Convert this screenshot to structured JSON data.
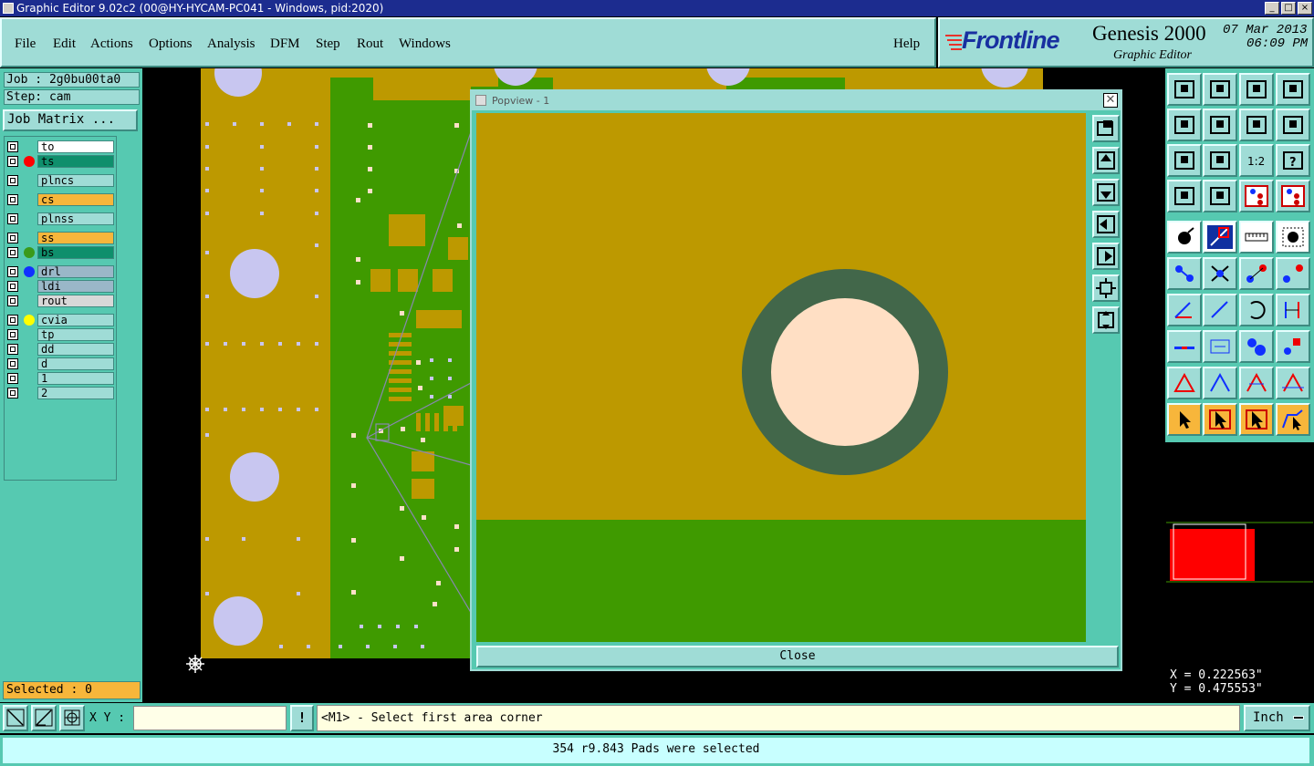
{
  "window": {
    "title": "Graphic Editor 9.02c2 (00@HY-HYCAM-PC041 - Windows, pid:2020)",
    "min": "_",
    "max": "□",
    "close": "×"
  },
  "menu": [
    "File",
    "Edit",
    "Actions",
    "Options",
    "Analysis",
    "DFM",
    "Step",
    "Rout",
    "Windows"
  ],
  "help": "Help",
  "brand": {
    "logo": "Frontline",
    "product": "Genesis 2000",
    "subtitle": "Graphic Editor",
    "date": "07 Mar 2013",
    "time": "06:09 PM"
  },
  "job": {
    "job_line": "Job : 2g0bu00ta0",
    "step_line": "Step: cam",
    "matrix_button": "Job Matrix ..."
  },
  "layers": [
    {
      "name": "to",
      "color": "#ffffff",
      "dot": ""
    },
    {
      "name": "ts",
      "color": "#0f8f6c",
      "dot": "#ff0000"
    },
    {
      "name": "plncs",
      "color": "#9fdcd6",
      "dot": ""
    },
    {
      "name": "cs",
      "color": "#f7b63b",
      "dot": ""
    },
    {
      "name": "plnss",
      "color": "#9fdcd6",
      "dot": ""
    },
    {
      "name": "ss",
      "color": "#f7b63b",
      "dot": ""
    },
    {
      "name": "bs",
      "color": "#0f8f6c",
      "dot": "#3a9a1a"
    },
    {
      "name": "drl",
      "color": "#9ab7c8",
      "dot": "#1030ff"
    },
    {
      "name": "ldi",
      "color": "#9ab7c8",
      "dot": ""
    },
    {
      "name": "rout",
      "color": "#d8d8d8",
      "dot": ""
    },
    {
      "name": "cvia",
      "color": "#9fdcd6",
      "dot": "#ffff00"
    },
    {
      "name": "tp",
      "color": "#9fdcd6",
      "dot": ""
    },
    {
      "name": "dd",
      "color": "#9fdcd6",
      "dot": ""
    },
    {
      "name": "d",
      "color": "#9fdcd6",
      "dot": ""
    },
    {
      "name": "1",
      "color": "#9fdcd6",
      "dot": ""
    },
    {
      "name": "2",
      "color": "#9fdcd6",
      "dot": ""
    }
  ],
  "selected": "Selected : 0",
  "popview": {
    "title": "Popview - 1",
    "close_label": "Close"
  },
  "coords": {
    "x": "X = 0.222563\"",
    "y": "Y = 0.475553\""
  },
  "xy_label": "X Y :",
  "xy_value": "",
  "prompt": "<M1> - Select first area corner",
  "units": "Inch",
  "status": "354 r9.843 Pads were selected",
  "colors": {
    "board_copper": "#bd9900",
    "solder_green": "#3f9a00",
    "pad_ring": "#42674a",
    "pad_center": "#ffdfc4",
    "panel": "#56c9b1",
    "button": "#9fdcd6",
    "drill": "#c8c6f0"
  }
}
